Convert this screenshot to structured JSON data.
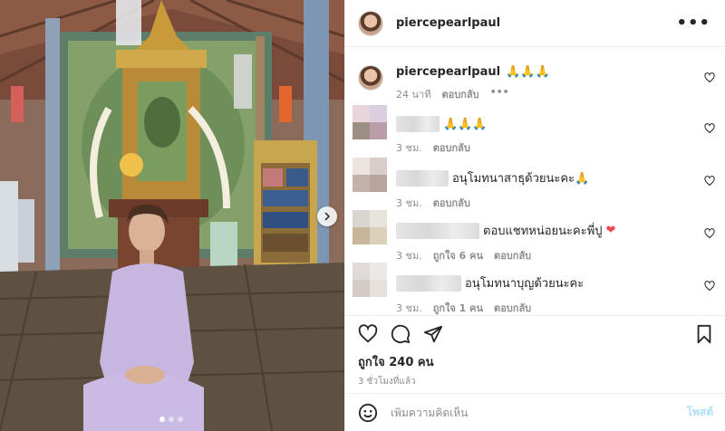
{
  "post": {
    "author": "piercepearlpaul",
    "caption_emoji": "🙏🙏🙏",
    "caption_time": "24 นาที",
    "caption_reply": "ตอบกลับ",
    "more": "•••",
    "likes": "ถูกใจ 240 คน",
    "posted_ago": "3 ชั่วโมงที่แล้ว"
  },
  "comments": [
    {
      "text": "🙏🙏🙏",
      "time": "3 ชม.",
      "likes": "",
      "reply": "ตอบกลับ",
      "avatar_colors": [
        "#e9d4dc",
        "#d9cfe0",
        "#9a8f82",
        "#b99da8"
      ]
    },
    {
      "text": "อนุโมทนาสาธุด้วยนะคะ🙏",
      "time": "3 ชม.",
      "likes": "",
      "reply": "ตอบกลับ",
      "avatar_colors": [
        "#ece4e1",
        "#d8cdc8",
        "#c4b2aa",
        "#b8a49c"
      ]
    },
    {
      "text": "ตอบแชทหน่อยนะคะพี่ปู",
      "time": "3 ชม.",
      "likes": "ถูกใจ 6 คน",
      "reply": "ตอบกลับ",
      "avatar_colors": [
        "#d8d6cf",
        "#e7e4dc",
        "#c8b59a",
        "#ddd0b9"
      ]
    },
    {
      "text": "อนุโมทนาบุญด้วยนะคะ",
      "time": "3 ชม.",
      "likes": "ถูกใจ 1 คน",
      "reply": "ตอบกลับ",
      "avatar_colors": [
        "#e0dbd8",
        "#ece8e5",
        "#d4cbc5",
        "#e6e0dc"
      ]
    }
  ],
  "comment_heart": "❤",
  "comment_input": {
    "placeholder": "เพิ่มความคิดเห็น",
    "post_label": "โพสต์"
  },
  "icons": {
    "like": "heart-icon",
    "comment": "comment-icon",
    "share": "share-icon",
    "save": "bookmark-icon",
    "emoji": "emoji-icon",
    "next": "chevron-right-icon"
  },
  "colors": {
    "heart_red": "#ed4956",
    "post_blue": "#b2dffc",
    "muted": "#8e8e8e"
  }
}
